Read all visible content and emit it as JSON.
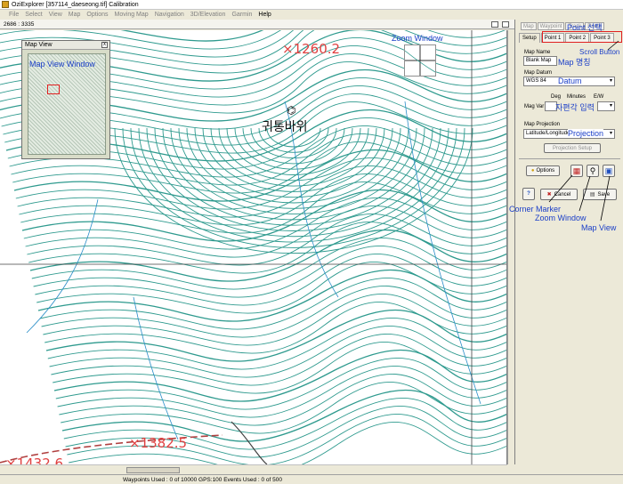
{
  "window": {
    "title": "OziExplorer [357114_daeseong.tif] Calibration"
  },
  "menu": [
    "File",
    "Select",
    "View",
    "Map",
    "Options",
    "Moving Map",
    "Navigation",
    "3D/Elevation",
    "Garmin",
    "Help"
  ],
  "coords": "2686 : 3335",
  "map": {
    "elev_top": "×1260.2",
    "elev_bottom": "×1382.5",
    "elev_bottom_left": "×1432.6",
    "place": "귀통바위"
  },
  "map_view": {
    "title": "Map View",
    "close": "x"
  },
  "annotations": {
    "map_view_window": "Map View Window",
    "zoom_window_top": "Zoom Window",
    "point_select": "Point 선택",
    "scroll_button": "Scroll Button",
    "map_name_note": "Map 명칭",
    "datum_note": "Datum",
    "magvar_note": "자편각 입력",
    "projection_note": "Projection",
    "corner_marker": "Corner Marker",
    "zoom_window": "Zoom Window",
    "map_view": "Map View"
  },
  "panel": {
    "top_tabs": [
      "Map",
      "Waypoint",
      "Track",
      "Route"
    ],
    "tabs": [
      "Setup",
      "Point 1",
      "Point 2",
      "Point 3"
    ],
    "map_name_label": "Map Name",
    "map_name_value": "Blank Map",
    "map_datum_label": "Map Datum",
    "map_datum_value": "WGS 84",
    "deg_label": "Deg",
    "minutes_label": "Minutes",
    "ew_label": "E/W",
    "mag_var_label": "Mag Var",
    "map_projection_label": "Map Projection",
    "map_projection_value": "Latitude/Longitude",
    "projection_setup": "Projection Setup",
    "options": "Options",
    "help": "?",
    "cancel": "Cancel",
    "save": "Save"
  },
  "status": "Waypoints Used : 0 of 10000   GPS:100 Events Used : 0 of 500"
}
